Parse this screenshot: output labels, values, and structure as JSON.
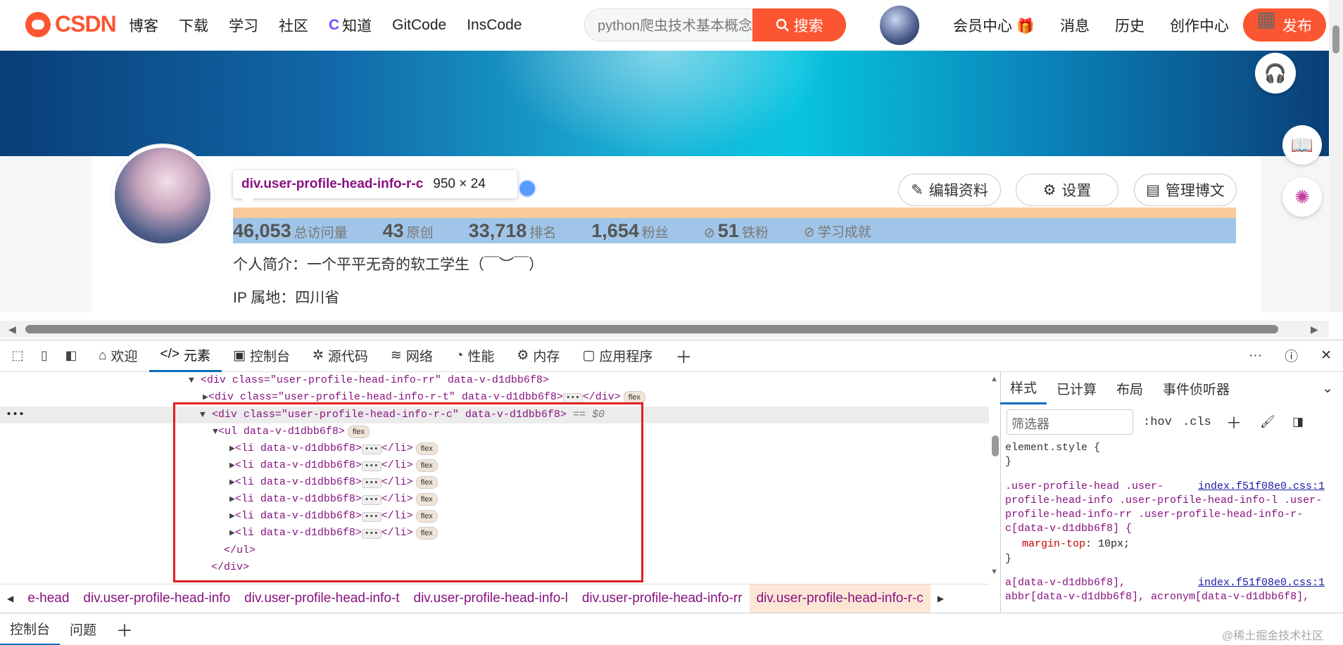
{
  "topnav": {
    "logo_text": "CSDN",
    "links": [
      "博客",
      "下载",
      "学习",
      "社区",
      "知道",
      "GitCode",
      "InsCode"
    ],
    "search_value": "python爬虫技术基本概念",
    "search_button": "搜索",
    "right_links": [
      "会员中心 🎁",
      "消息",
      "历史",
      "创作中心"
    ],
    "publish_label": "发布"
  },
  "profile": {
    "tooltip_selector": "div.user-profile-head-info-r-c",
    "tooltip_size": "950 × 24",
    "stats": [
      {
        "num": "46,053",
        "label": "总访问量"
      },
      {
        "num": "43",
        "label": "原创"
      },
      {
        "num": "33,718",
        "label": "排名"
      },
      {
        "num": "1,654",
        "label": "粉丝"
      },
      {
        "num": "51",
        "label": "铁粉"
      },
      {
        "num": "",
        "label": "学习成就"
      }
    ],
    "buttons": [
      "编辑资料",
      "设置",
      "管理博文"
    ],
    "bio": "个人简介：一个平平无奇的软工学生（￣︶￣）",
    "ip": "IP 属地：四川省"
  },
  "devtools": {
    "tabs": [
      "欢迎",
      "元素",
      "控制台",
      "源代码",
      "网络",
      "性能",
      "内存",
      "应用程序"
    ],
    "active_tab": "元素",
    "tree": {
      "l1_tag": "<div class=\"user-profile-head-info-rr\" data-v-d1dbb6f8>",
      "l2_tag": "<div class=\"user-profile-head-info-r-t\" data-v-d1dbb6f8>",
      "l2_close": "</div>",
      "l3_tag": "<div class=\"user-profile-head-info-r-c\" data-v-d1dbb6f8>",
      "l3_eq": "== $0",
      "ul_tag": "<ul data-v-d1dbb6f8>",
      "li_tag": "<li data-v-d1dbb6f8>",
      "li_close": "</li>",
      "ul_close": "</ul>",
      "div_close": "</div>",
      "pill": "flex",
      "ellipsis": "•••"
    },
    "breadcrumb": [
      "e-head",
      "div.user-profile-head-info",
      "div.user-profile-head-info-t",
      "div.user-profile-head-info-l",
      "div.user-profile-head-info-rr",
      "div.user-profile-head-info-r-c"
    ],
    "styles_tabs": [
      "样式",
      "已计算",
      "布局",
      "事件侦听器"
    ],
    "filter_placeholder": "筛选器",
    "hov": ":hov",
    "cls": ".cls",
    "element_style": "element.style {",
    "close_brace": "}",
    "rule1_sel_1": ".user-profile-head .user-",
    "rule1_sel_2": "profile-head-info .user-profile-head-info-l .user-",
    "rule1_sel_3": "profile-head-info-rr .user-profile-head-info-r-",
    "rule1_sel_4": "c[data-v-d1dbb6f8] {",
    "rule1_link": "index.f51f08e0.css:1",
    "rule1_prop": "margin-top",
    "rule1_val": "10px;",
    "rule2_sel_1": "a[data-v-d1dbb6f8],",
    "rule2_sel_2": "abbr[data-v-d1dbb6f8], acronym[data-v-d1dbb6f8],",
    "rule2_link": "index.f51f08e0.css:1",
    "bottom_tabs": [
      "控制台",
      "问题"
    ]
  },
  "watermark": "@稀土掘金技术社区"
}
